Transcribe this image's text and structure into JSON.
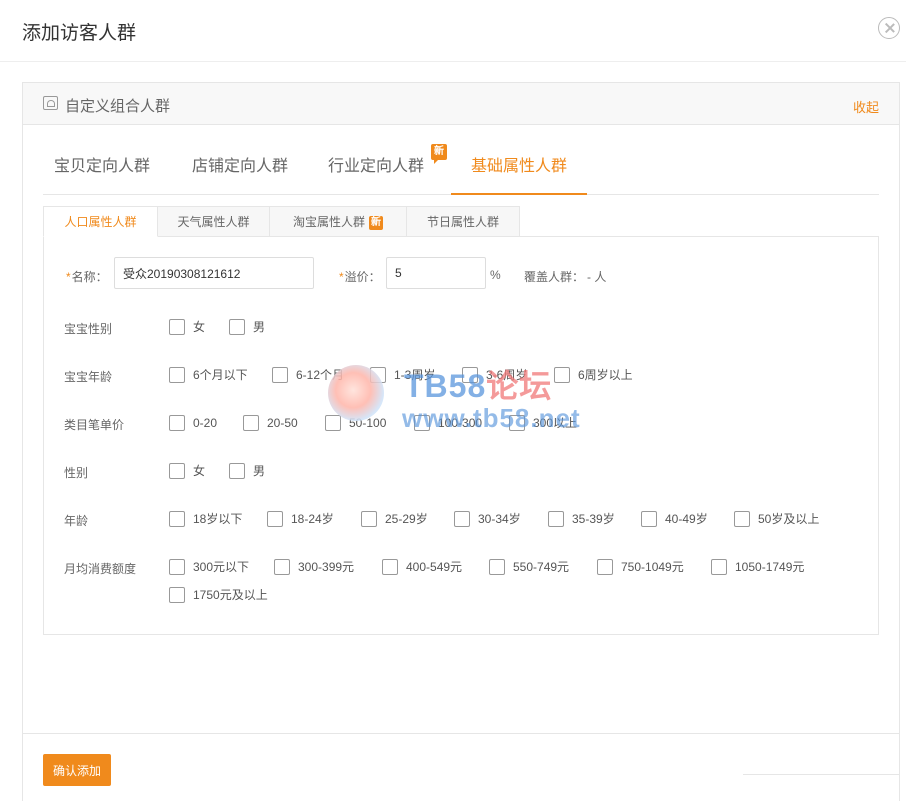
{
  "dialog": {
    "title": "添加访客人群"
  },
  "panel": {
    "title": "自定义组合人群",
    "collapse": "收起"
  },
  "main_tabs": [
    {
      "label": "宝贝定向人群"
    },
    {
      "label": "店铺定向人群"
    },
    {
      "label": "行业定向人群",
      "badge": "新"
    },
    {
      "label": "基础属性人群",
      "active": true
    }
  ],
  "sub_tabs": [
    {
      "label": "人口属性人群",
      "active": true
    },
    {
      "label": "天气属性人群"
    },
    {
      "label": "淘宝属性人群",
      "badge": "新"
    },
    {
      "label": "节日属性人群"
    }
  ],
  "form": {
    "name_req": "*",
    "name_label": "名称：",
    "name_value": "受众20190308121612",
    "premium_req": "*",
    "premium_label": "溢价：",
    "premium_value": "5",
    "premium_unit": "%",
    "coverage_label": "覆盖人群：",
    "coverage_value": "- 人"
  },
  "rows": [
    {
      "label": "宝宝性别",
      "options": [
        "女",
        "男"
      ]
    },
    {
      "label": "宝宝年龄",
      "options": [
        "6个月以下",
        "6-12个月",
        "1-3周岁",
        "3-6周岁",
        "6周岁以上"
      ]
    },
    {
      "label": "类目笔单价",
      "options": [
        "0-20",
        "20-50",
        "50-100",
        "100-300",
        "300以上"
      ]
    },
    {
      "label": "性别",
      "options": [
        "女",
        "男"
      ]
    },
    {
      "label": "年龄",
      "options": [
        "18岁以下",
        "18-24岁",
        "25-29岁",
        "30-34岁",
        "35-39岁",
        "40-49岁",
        "50岁及以上"
      ]
    },
    {
      "label": "月均消费额度",
      "options": [
        "300元以下",
        "300-399元",
        "400-549元",
        "550-749元",
        "750-1049元",
        "1050-1749元",
        "1750元及以上"
      ]
    }
  ],
  "footer": {
    "confirm": "确认添加"
  },
  "watermark": {
    "line1_a": "TB58",
    "line1_b": "论坛",
    "line2": "www.tb58.net"
  },
  "colors": {
    "accent": "#f08a1c",
    "border": "#e6e6e6"
  }
}
